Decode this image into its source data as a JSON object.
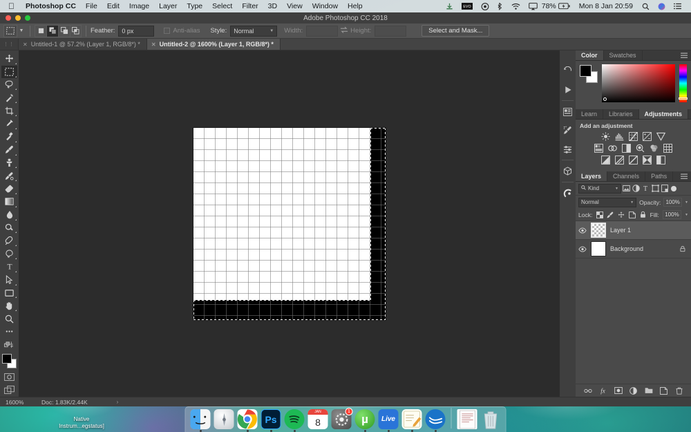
{
  "menubar": {
    "apple": "apple-logo",
    "app_name": "Photoshop CC",
    "items": [
      "File",
      "Edit",
      "Image",
      "Layer",
      "Type",
      "Select",
      "Filter",
      "3D",
      "View",
      "Window",
      "Help"
    ],
    "status_icons": [
      "download-icon",
      "evo-icon",
      "creative-cloud-icon",
      "bluetooth-icon",
      "wifi-icon",
      "airplay-icon"
    ],
    "battery_percent": "78%",
    "clock": "Mon 8 Jan  20:59",
    "right_icons": [
      "search-icon",
      "siri-icon",
      "notification-center-icon"
    ]
  },
  "window": {
    "title": "Adobe Photoshop CC 2018"
  },
  "options_bar": {
    "tool_icon": "rectangular-marquee-icon",
    "selection_modes": [
      "new-selection",
      "add-to-selection",
      "subtract-from-selection",
      "intersect-selection"
    ],
    "active_mode_index": 1,
    "feather_label": "Feather:",
    "feather_value": "0 px",
    "antialias_label": "Anti-alias",
    "antialias_checked": false,
    "style_label": "Style:",
    "style_value": "Normal",
    "width_label": "Width:",
    "width_value": "",
    "height_label": "Height:",
    "height_value": "",
    "swap_icon": "swap-dimensions-icon",
    "select_and_mask": "Select and Mask..."
  },
  "tabs": [
    {
      "title": "Untitled-1 @ 57.2% (Layer 1, RGB/8*) *",
      "active": false
    },
    {
      "title": "Untitled-2 @ 1600% (Layer 1, RGB/8*) *",
      "active": true
    }
  ],
  "toolbar": {
    "tools": [
      {
        "name": "move-tool",
        "active": false
      },
      {
        "name": "rectangular-marquee-tool",
        "active": true
      },
      {
        "name": "lasso-tool",
        "active": false
      },
      {
        "name": "magic-wand-tool",
        "active": false
      },
      {
        "name": "crop-tool",
        "active": false
      },
      {
        "name": "eyedropper-tool",
        "active": false
      },
      {
        "name": "spot-healing-brush-tool",
        "active": false
      },
      {
        "name": "brush-tool",
        "active": false
      },
      {
        "name": "clone-stamp-tool",
        "active": false
      },
      {
        "name": "history-brush-tool",
        "active": false
      },
      {
        "name": "eraser-tool",
        "active": false
      },
      {
        "name": "gradient-tool",
        "active": false
      },
      {
        "name": "blur-tool",
        "active": false
      },
      {
        "name": "dodge-tool",
        "active": false
      },
      {
        "name": "pen-tool",
        "active": false
      },
      {
        "name": "type-tool",
        "active": false
      },
      {
        "name": "path-selection-tool",
        "active": false
      },
      {
        "name": "rectangle-tool",
        "active": false
      },
      {
        "name": "hand-tool",
        "active": false
      },
      {
        "name": "zoom-tool",
        "active": false
      },
      {
        "name": "edit-toolbar-tool",
        "active": false
      }
    ],
    "foreground_color": "#000000",
    "background_color": "#ffffff",
    "quick_mask": "quick-mask-icon",
    "screen_mode": "screen-mode-icon"
  },
  "icon_rail": [
    "history-icon",
    "actions-play-icon",
    "properties-icon",
    "brush-settings-icon",
    "adjustments-sliders-icon",
    "3d-cube-icon",
    "creative-cloud-icon"
  ],
  "color_panel": {
    "tabs": [
      {
        "label": "Color",
        "active": true
      },
      {
        "label": "Swatches",
        "active": false
      }
    ],
    "menu_icon": "panel-menu-icon",
    "foreground": "#000000",
    "background": "#ffffff",
    "hue": "#ff0000"
  },
  "adjustments_panel": {
    "tabs": [
      {
        "label": "Learn",
        "active": false
      },
      {
        "label": "Libraries",
        "active": false
      },
      {
        "label": "Adjustments",
        "active": true
      }
    ],
    "menu_icon": "panel-menu-icon",
    "heading": "Add an adjustment",
    "rows": [
      [
        "brightness-contrast-icon",
        "levels-icon",
        "curves-icon",
        "exposure-icon",
        "vibrance-icon"
      ],
      [
        "hue-saturation-icon",
        "color-balance-icon",
        "black-white-icon",
        "photo-filter-icon",
        "channel-mixer-icon",
        "color-lookup-icon"
      ],
      [
        "invert-icon",
        "posterize-icon",
        "threshold-icon",
        "gradient-map-icon",
        "selective-color-icon"
      ]
    ]
  },
  "layers_panel": {
    "tabs": [
      {
        "label": "Layers",
        "active": true
      },
      {
        "label": "Channels",
        "active": false
      },
      {
        "label": "Paths",
        "active": false
      }
    ],
    "menu_icon": "panel-menu-icon",
    "filter_label": "Kind",
    "filter_icons": [
      "filter-pixel-icon",
      "filter-adjustment-icon",
      "filter-type-icon",
      "filter-shape-icon",
      "filter-smart-object-icon"
    ],
    "blend_mode": "Normal",
    "opacity_label": "Opacity:",
    "opacity_value": "100%",
    "lock_label": "Lock:",
    "lock_icons": [
      "lock-transparent-pixels-icon",
      "lock-image-pixels-icon",
      "lock-position-icon",
      "lock-artboard-icon",
      "lock-all-icon"
    ],
    "fill_label": "Fill:",
    "fill_value": "100%",
    "layers": [
      {
        "name": "Layer 1",
        "visible": true,
        "selected": true,
        "thumb": "transparent",
        "locked": false
      },
      {
        "name": "Background",
        "visible": true,
        "selected": false,
        "thumb": "white",
        "locked": true
      }
    ],
    "bottom_icons": [
      "link-layers-icon",
      "layer-style-fx-icon",
      "add-layer-mask-icon",
      "new-adjustment-layer-icon",
      "new-group-icon",
      "new-layer-icon",
      "delete-layer-icon"
    ]
  },
  "statusbar": {
    "zoom": "1600%",
    "doc_info": "Doc: 1.83K/2.44K",
    "arrow": "›"
  },
  "canvas": {
    "document_background": "#ffffff",
    "painted_color": "#000000",
    "zoom_level": "1600%",
    "pixel_grid": true,
    "selection": "marching-ants"
  },
  "dock": {
    "items": [
      {
        "name": "finder",
        "label": "Finder",
        "glyph": "",
        "bg": "#3fa9f5",
        "running": true
      },
      {
        "name": "launchpad",
        "label": "Launchpad",
        "glyph": "",
        "bg": "#d8d8d8",
        "running": false
      },
      {
        "name": "chrome",
        "label": "Google Chrome",
        "glyph": "",
        "bg": "#ffffff",
        "running": true
      },
      {
        "name": "photoshop",
        "label": "Ps",
        "glyph": "Ps",
        "bg": "#001e36",
        "running": true
      },
      {
        "name": "spotify",
        "label": "Spotify",
        "glyph": "",
        "bg": "#1db954",
        "running": true
      },
      {
        "name": "calendar",
        "label": "8",
        "glyph": "8",
        "bg": "#ffffff",
        "running": false
      },
      {
        "name": "system-preferences",
        "label": "System Preferences",
        "glyph": "",
        "bg": "#6e6e6e",
        "running": false,
        "badge": "1"
      },
      {
        "name": "utorrent",
        "label": "µ",
        "glyph": "µ",
        "bg": "#4fbf3f",
        "running": true
      },
      {
        "name": "ableton-live",
        "label": "Live",
        "glyph": "Live",
        "bg": "#2a74d8",
        "running": true
      },
      {
        "name": "notes",
        "label": "Notes",
        "glyph": "",
        "bg": "#f5d76e",
        "running": true
      },
      {
        "name": "openoffice",
        "label": "OpenOffice",
        "glyph": "",
        "bg": "#1a73c8",
        "running": true
      }
    ],
    "trailing": [
      {
        "name": "documents-stack",
        "label": "Documents"
      },
      {
        "name": "trash",
        "label": "Trash"
      }
    ]
  },
  "desktop": {
    "icon_label_line1": "Native",
    "icon_label_line2": "Instrum...egstatus]"
  }
}
